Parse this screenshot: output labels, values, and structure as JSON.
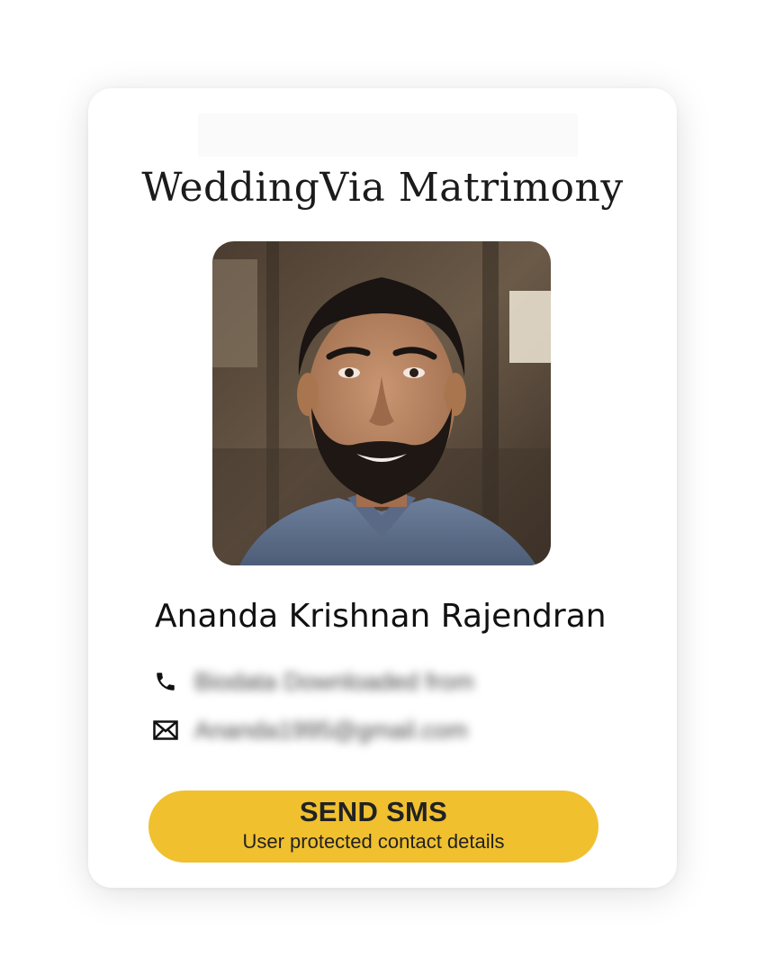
{
  "card": {
    "brand_title": "WeddingVia Matrimony",
    "profile": {
      "name": "Ananda Krishnan Rajendran",
      "photo_alt": "Profile photo"
    },
    "contacts": {
      "phone_icon": "phone-icon",
      "phone_value": "Biodata Downloaded from",
      "email_icon": "mail-icon",
      "email_value": "Ananda1995@gmail.com"
    },
    "sms_button": {
      "label": "SEND SMS",
      "sublabel": "User protected contact details",
      "color": "#f0c02f"
    }
  }
}
